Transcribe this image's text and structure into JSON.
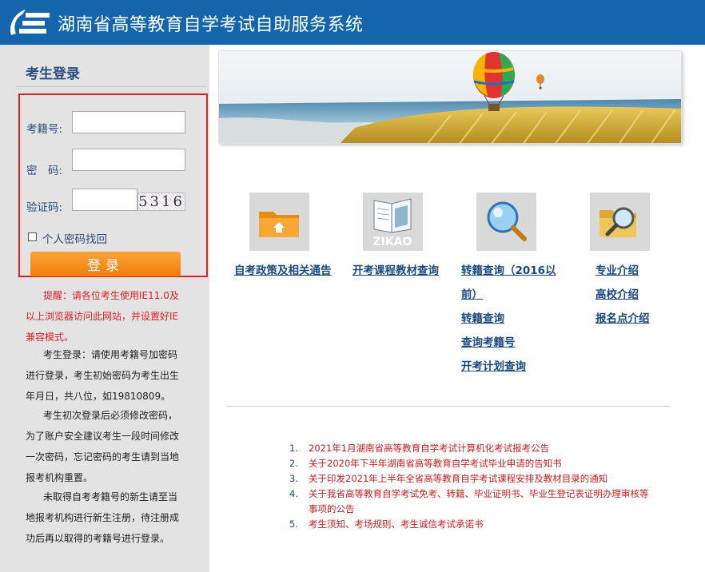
{
  "header": {
    "title": "湖南省高等教育自学考试自助服务系统"
  },
  "login": {
    "title": "考生登录",
    "id_label": "考籍号:",
    "id_value": "",
    "password_label": "密　码:",
    "password_value": "",
    "captcha_label": "验证码:",
    "captcha_value": "",
    "captcha_image_text": "5316",
    "forgot_label": "个人密码找回",
    "forgot_checked": false,
    "submit_label": "登录"
  },
  "notices": {
    "warning": "提醒：请各位考生使用IE11.0及以上浏览器访问此网站，并设置好IE兼容模式。",
    "login_help": "考生登录：请使用考籍号加密码进行登录，考生初始密码为考生出生年月日，共八位，如19810809。",
    "first_login": "考生初次登录后必须修改密码，为了账户安全建议考生一段时间修改一次密码，忘记密码的考生请到当地报考机构重置。",
    "no_id": "未取得自考考籍号的新生请至当地报考机构进行新生注册，待注册成功后再以取得的考籍号进行登录。"
  },
  "tiles": [
    {
      "icon": "folder-home-icon",
      "links": [
        "自考政策及相关通告"
      ]
    },
    {
      "icon": "zikao-book-icon",
      "icon_text": "ZIKAO",
      "links": [
        "开考课程教材查询"
      ]
    },
    {
      "icon": "magnifier-icon",
      "links": [
        "转籍查询（2016以前）",
        "转籍查询",
        "查询考籍号",
        "开考计划查询"
      ]
    },
    {
      "icon": "folder-search-icon",
      "links": [
        "专业介绍",
        "高校介绍",
        "报名点介绍"
      ]
    }
  ],
  "news": [
    {
      "num": "1.",
      "text": "2021年1月湖南省高等教育自学考试计算机化考试报考公告"
    },
    {
      "num": "2.",
      "text": "关于2020年下半年湖南省高等教育自学考试毕业申请的告知书"
    },
    {
      "num": "3.",
      "text": "关于印发2021年上半年全省高等教育自学考试课程安排及教材目录的通知"
    },
    {
      "num": "4.",
      "text": "关于我省高等教育自学考试免考、转籍、毕业证明书、毕业生登记表证明办理审核等事项的公告"
    },
    {
      "num": "5.",
      "text": "考生须知、考场规则、考生诚信考试承诺书"
    }
  ],
  "colors": {
    "header_bg": "#1565ad",
    "login_button": "#f58c1e",
    "notice_red": "#e02020",
    "link_blue": "#1a4a80"
  }
}
